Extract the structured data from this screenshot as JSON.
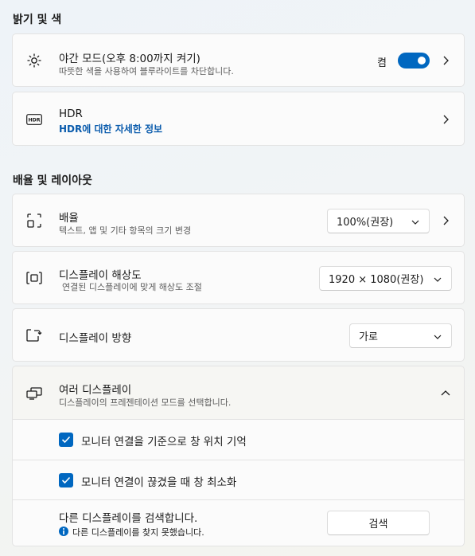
{
  "sections": {
    "brightness_color": "밝기 및 색",
    "scale_layout": "배율 및 레이아웃"
  },
  "night_light": {
    "title": "야간 모드(오후 8:00까지 켜기)",
    "subtitle": "따뜻한 색을 사용하여 블루라이트를 차단합니다.",
    "toggle_state_label": "켬",
    "toggle_on": true,
    "icon": "sun-brightness-icon"
  },
  "hdr": {
    "title": "HDR",
    "link": "HDR에 대한 자세한 정보",
    "icon": "hdr-icon"
  },
  "scale": {
    "title": "배율",
    "subtitle": "텍스트, 앱 및 기타 항목의 크기 변경",
    "value": "100%(권장)",
    "icon": "scale-icon"
  },
  "resolution": {
    "title": "디스플레이 해상도",
    "subtitle": "연결된 디스플레이에 맞게 해상도 조절",
    "value": "1920 × 1080(권장)",
    "icon": "resolution-icon"
  },
  "orientation": {
    "title": "디스플레이 방향",
    "value": "가로",
    "icon": "orientation-icon"
  },
  "multiple_displays": {
    "title": "여러 디스플레이",
    "subtitle": "디스플레이의 프레젠테이션 모드를 선택합니다.",
    "expanded": true,
    "icon": "multiple-displays-icon",
    "options": [
      {
        "label": "모니터 연결을 기준으로 창 위치 기억",
        "checked": true
      },
      {
        "label": "모니터 연결이 끊겼을 때 창 최소화",
        "checked": true
      }
    ],
    "detect": {
      "title": "다른 디스플레이를 검색합니다.",
      "info": "다른 디스플레이를 찾지 못했습니다.",
      "button": "검색"
    }
  },
  "colors": {
    "accent": "#0067c0",
    "link": "#0b5cad"
  }
}
